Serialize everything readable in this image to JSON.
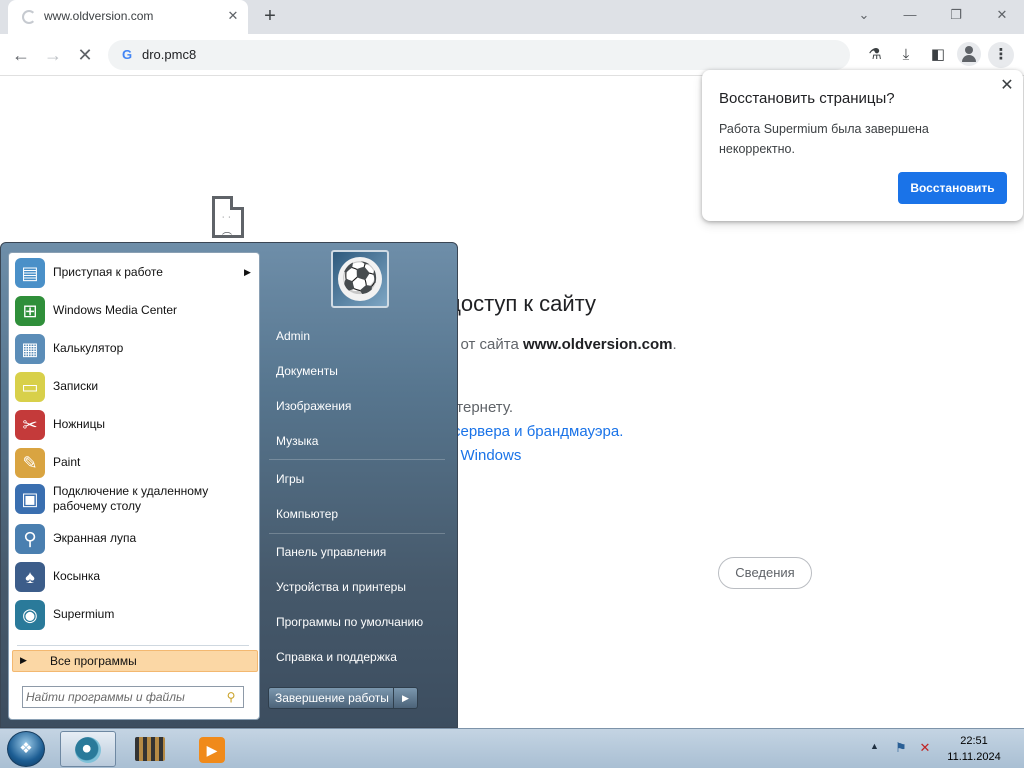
{
  "browser": {
    "tab": {
      "title": "www.oldversion.com"
    },
    "address": "dro.pmc8",
    "window_controls": [
      "⌄",
      "—",
      "❐",
      "✕"
    ]
  },
  "error_page": {
    "heading": "доступ к сайту",
    "line1_prefix": "а от сайта",
    "line1_site": "www.oldversion.com",
    "line1_suffix": ".",
    "line2": "нтернету.",
    "link1": "-сервера и брандмауэра.",
    "link2": "е Windows",
    "details_button": "Сведения"
  },
  "restore_popup": {
    "title": "Восстановить страницы?",
    "message": "Работа Supermium была завершена некорректно.",
    "button": "Восстановить"
  },
  "start_menu": {
    "programs": [
      {
        "label": "Приступая к работе",
        "icon": "getting-started-icon",
        "color": "#4a90c8",
        "has_arrow": true
      },
      {
        "label": "Windows Media Center",
        "icon": "media-center-icon",
        "color": "#2f8f3a",
        "has_arrow": false
      },
      {
        "label": "Калькулятор",
        "icon": "calculator-icon",
        "color": "#5b8db8",
        "has_arrow": false
      },
      {
        "label": "Записки",
        "icon": "sticky-notes-icon",
        "color": "#d8d04a",
        "has_arrow": false
      },
      {
        "label": "Ножницы",
        "icon": "scissors-icon",
        "color": "#c43a3a",
        "has_arrow": false
      },
      {
        "label": "Paint",
        "icon": "paint-icon",
        "color": "#d9a441",
        "has_arrow": false
      },
      {
        "label": "Подключение к удаленному рабочему столу",
        "icon": "remote-desktop-icon",
        "color": "#3a6fb0",
        "has_arrow": false
      },
      {
        "label": "Экранная лупа",
        "icon": "magnifier-icon",
        "color": "#4a7fb0",
        "has_arrow": false
      },
      {
        "label": "Косынка",
        "icon": "solitaire-icon",
        "color": "#3c5d8a",
        "has_arrow": false
      },
      {
        "label": "Supermium",
        "icon": "supermium-icon",
        "color": "#2a7a9a",
        "has_arrow": false
      }
    ],
    "all_programs": "Все программы",
    "search_placeholder": "Найти программы и файлы",
    "right_items": [
      "Admin",
      "Документы",
      "Изображения",
      "Музыка",
      "Игры",
      "Компьютер",
      "Панель управления",
      "Устройства и принтеры",
      "Программы по умолчанию",
      "Справка и поддержка"
    ],
    "shutdown": "Завершение работы"
  },
  "taskbar": {
    "apps": [
      "supermium-icon",
      "film-icon",
      "media-player-icon"
    ],
    "time": "22:51",
    "date": "11.11.2024"
  }
}
